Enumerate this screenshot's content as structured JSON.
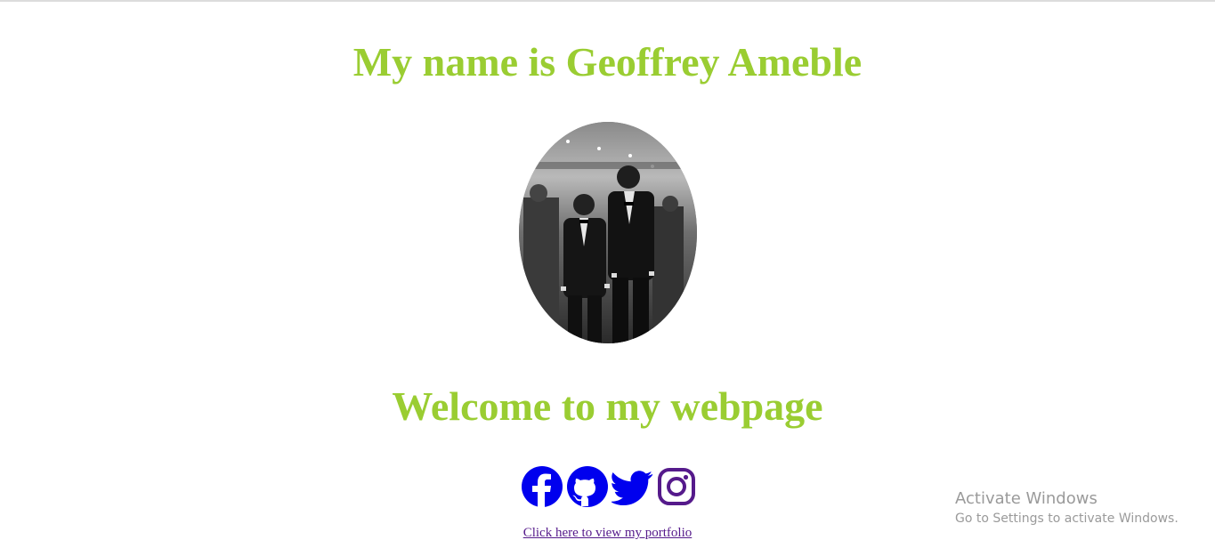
{
  "header": {
    "name_heading": "My name is Geoffrey Ameble"
  },
  "main": {
    "welcome_heading": "Welcome to my webpage",
    "portfolio_link_text": "Click here to view my portfolio"
  },
  "social": [
    {
      "name": "facebook-icon"
    },
    {
      "name": "github-icon"
    },
    {
      "name": "twitter-icon"
    },
    {
      "name": "instagram-icon"
    }
  ],
  "watermark": {
    "title": "Activate Windows",
    "subtitle": "Go to Settings to activate Windows."
  },
  "colors": {
    "heading": "#9acd32",
    "social_blue": "#0000ee",
    "visited_purple": "#551a8b",
    "watermark": "#9a9a9a"
  }
}
